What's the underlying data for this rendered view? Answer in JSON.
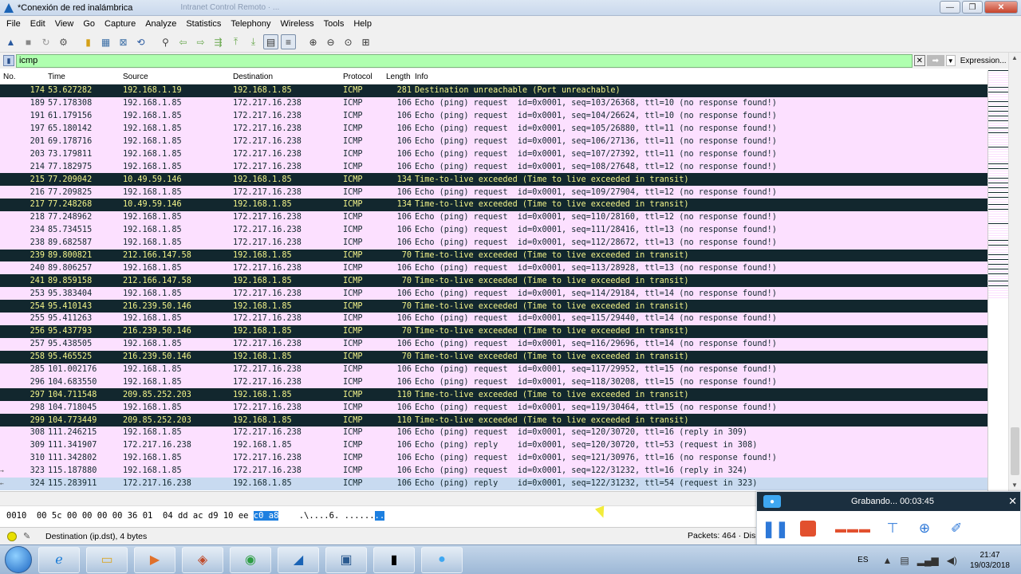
{
  "window": {
    "title": "*Conexión de red inalámbrica",
    "ghost_tabs": "Intranet Control Remoto · ..."
  },
  "menu": [
    "File",
    "Edit",
    "View",
    "Go",
    "Capture",
    "Analyze",
    "Statistics",
    "Telephony",
    "Wireless",
    "Tools",
    "Help"
  ],
  "filter": {
    "value": "icmp",
    "expression_label": "Expression...",
    "plus_label": "+"
  },
  "columns": {
    "no": "No.",
    "time": "Time",
    "source": "Source",
    "destination": "Destination",
    "protocol": "Protocol",
    "length": "Length",
    "info": "Info"
  },
  "packets": [
    {
      "no": "174",
      "time": "53.627282",
      "src": "192.168.1.19",
      "dst": "192.168.1.85",
      "proto": "ICMP",
      "len": "281",
      "info": "Destination unreachable (Port unreachable)",
      "type": "err"
    },
    {
      "no": "189",
      "time": "57.178308",
      "src": "192.168.1.85",
      "dst": "172.217.16.238",
      "proto": "ICMP",
      "len": "106",
      "info": "Echo (ping) request  id=0x0001, seq=103/26368, ttl=10 (no response found!)",
      "type": "normal"
    },
    {
      "no": "191",
      "time": "61.179156",
      "src": "192.168.1.85",
      "dst": "172.217.16.238",
      "proto": "ICMP",
      "len": "106",
      "info": "Echo (ping) request  id=0x0001, seq=104/26624, ttl=10 (no response found!)",
      "type": "normal"
    },
    {
      "no": "197",
      "time": "65.180142",
      "src": "192.168.1.85",
      "dst": "172.217.16.238",
      "proto": "ICMP",
      "len": "106",
      "info": "Echo (ping) request  id=0x0001, seq=105/26880, ttl=11 (no response found!)",
      "type": "normal"
    },
    {
      "no": "201",
      "time": "69.178716",
      "src": "192.168.1.85",
      "dst": "172.217.16.238",
      "proto": "ICMP",
      "len": "106",
      "info": "Echo (ping) request  id=0x0001, seq=106/27136, ttl=11 (no response found!)",
      "type": "normal"
    },
    {
      "no": "203",
      "time": "73.179811",
      "src": "192.168.1.85",
      "dst": "172.217.16.238",
      "proto": "ICMP",
      "len": "106",
      "info": "Echo (ping) request  id=0x0001, seq=107/27392, ttl=11 (no response found!)",
      "type": "normal"
    },
    {
      "no": "214",
      "time": "77.182975",
      "src": "192.168.1.85",
      "dst": "172.217.16.238",
      "proto": "ICMP",
      "len": "106",
      "info": "Echo (ping) request  id=0x0001, seq=108/27648, ttl=12 (no response found!)",
      "type": "normal"
    },
    {
      "no": "215",
      "time": "77.209042",
      "src": "10.49.59.146",
      "dst": "192.168.1.85",
      "proto": "ICMP",
      "len": "134",
      "info": "Time-to-live exceeded (Time to live exceeded in transit)",
      "type": "err"
    },
    {
      "no": "216",
      "time": "77.209825",
      "src": "192.168.1.85",
      "dst": "172.217.16.238",
      "proto": "ICMP",
      "len": "106",
      "info": "Echo (ping) request  id=0x0001, seq=109/27904, ttl=12 (no response found!)",
      "type": "normal"
    },
    {
      "no": "217",
      "time": "77.248268",
      "src": "10.49.59.146",
      "dst": "192.168.1.85",
      "proto": "ICMP",
      "len": "134",
      "info": "Time-to-live exceeded (Time to live exceeded in transit)",
      "type": "err"
    },
    {
      "no": "218",
      "time": "77.248962",
      "src": "192.168.1.85",
      "dst": "172.217.16.238",
      "proto": "ICMP",
      "len": "106",
      "info": "Echo (ping) request  id=0x0001, seq=110/28160, ttl=12 (no response found!)",
      "type": "normal"
    },
    {
      "no": "234",
      "time": "85.734515",
      "src": "192.168.1.85",
      "dst": "172.217.16.238",
      "proto": "ICMP",
      "len": "106",
      "info": "Echo (ping) request  id=0x0001, seq=111/28416, ttl=13 (no response found!)",
      "type": "normal"
    },
    {
      "no": "238",
      "time": "89.682587",
      "src": "192.168.1.85",
      "dst": "172.217.16.238",
      "proto": "ICMP",
      "len": "106",
      "info": "Echo (ping) request  id=0x0001, seq=112/28672, ttl=13 (no response found!)",
      "type": "normal"
    },
    {
      "no": "239",
      "time": "89.800821",
      "src": "212.166.147.58",
      "dst": "192.168.1.85",
      "proto": "ICMP",
      "len": "70",
      "info": "Time-to-live exceeded (Time to live exceeded in transit)",
      "type": "err"
    },
    {
      "no": "240",
      "time": "89.806257",
      "src": "192.168.1.85",
      "dst": "172.217.16.238",
      "proto": "ICMP",
      "len": "106",
      "info": "Echo (ping) request  id=0x0001, seq=113/28928, ttl=13 (no response found!)",
      "type": "normal"
    },
    {
      "no": "241",
      "time": "89.859158",
      "src": "212.166.147.58",
      "dst": "192.168.1.85",
      "proto": "ICMP",
      "len": "70",
      "info": "Time-to-live exceeded (Time to live exceeded in transit)",
      "type": "err"
    },
    {
      "no": "253",
      "time": "95.383404",
      "src": "192.168.1.85",
      "dst": "172.217.16.238",
      "proto": "ICMP",
      "len": "106",
      "info": "Echo (ping) request  id=0x0001, seq=114/29184, ttl=14 (no response found!)",
      "type": "normal"
    },
    {
      "no": "254",
      "time": "95.410143",
      "src": "216.239.50.146",
      "dst": "192.168.1.85",
      "proto": "ICMP",
      "len": "70",
      "info": "Time-to-live exceeded (Time to live exceeded in transit)",
      "type": "err"
    },
    {
      "no": "255",
      "time": "95.411263",
      "src": "192.168.1.85",
      "dst": "172.217.16.238",
      "proto": "ICMP",
      "len": "106",
      "info": "Echo (ping) request  id=0x0001, seq=115/29440, ttl=14 (no response found!)",
      "type": "normal"
    },
    {
      "no": "256",
      "time": "95.437793",
      "src": "216.239.50.146",
      "dst": "192.168.1.85",
      "proto": "ICMP",
      "len": "70",
      "info": "Time-to-live exceeded (Time to live exceeded in transit)",
      "type": "err"
    },
    {
      "no": "257",
      "time": "95.438505",
      "src": "192.168.1.85",
      "dst": "172.217.16.238",
      "proto": "ICMP",
      "len": "106",
      "info": "Echo (ping) request  id=0x0001, seq=116/29696, ttl=14 (no response found!)",
      "type": "normal"
    },
    {
      "no": "258",
      "time": "95.465525",
      "src": "216.239.50.146",
      "dst": "192.168.1.85",
      "proto": "ICMP",
      "len": "70",
      "info": "Time-to-live exceeded (Time to live exceeded in transit)",
      "type": "err"
    },
    {
      "no": "285",
      "time": "101.002176",
      "src": "192.168.1.85",
      "dst": "172.217.16.238",
      "proto": "ICMP",
      "len": "106",
      "info": "Echo (ping) request  id=0x0001, seq=117/29952, ttl=15 (no response found!)",
      "type": "normal"
    },
    {
      "no": "296",
      "time": "104.683550",
      "src": "192.168.1.85",
      "dst": "172.217.16.238",
      "proto": "ICMP",
      "len": "106",
      "info": "Echo (ping) request  id=0x0001, seq=118/30208, ttl=15 (no response found!)",
      "type": "normal"
    },
    {
      "no": "297",
      "time": "104.711548",
      "src": "209.85.252.203",
      "dst": "192.168.1.85",
      "proto": "ICMP",
      "len": "110",
      "info": "Time-to-live exceeded (Time to live exceeded in transit)",
      "type": "err"
    },
    {
      "no": "298",
      "time": "104.718045",
      "src": "192.168.1.85",
      "dst": "172.217.16.238",
      "proto": "ICMP",
      "len": "106",
      "info": "Echo (ping) request  id=0x0001, seq=119/30464, ttl=15 (no response found!)",
      "type": "normal"
    },
    {
      "no": "299",
      "time": "104.773449",
      "src": "209.85.252.203",
      "dst": "192.168.1.85",
      "proto": "ICMP",
      "len": "110",
      "info": "Time-to-live exceeded (Time to live exceeded in transit)",
      "type": "err"
    },
    {
      "no": "308",
      "time": "111.246215",
      "src": "192.168.1.85",
      "dst": "172.217.16.238",
      "proto": "ICMP",
      "len": "106",
      "info": "Echo (ping) request  id=0x0001, seq=120/30720, ttl=16 (reply in 309)",
      "type": "normal"
    },
    {
      "no": "309",
      "time": "111.341907",
      "src": "172.217.16.238",
      "dst": "192.168.1.85",
      "proto": "ICMP",
      "len": "106",
      "info": "Echo (ping) reply    id=0x0001, seq=120/30720, ttl=53 (request in 308)",
      "type": "normal"
    },
    {
      "no": "310",
      "time": "111.342802",
      "src": "192.168.1.85",
      "dst": "172.217.16.238",
      "proto": "ICMP",
      "len": "106",
      "info": "Echo (ping) request  id=0x0001, seq=121/30976, ttl=16 (no response found!)",
      "type": "normal"
    },
    {
      "no": "323",
      "time": "115.187880",
      "src": "192.168.1.85",
      "dst": "172.217.16.238",
      "proto": "ICMP",
      "len": "106",
      "info": "Echo (ping) request  id=0x0001, seq=122/31232, ttl=16 (reply in 324)",
      "type": "normal",
      "mark": "→"
    },
    {
      "no": "324",
      "time": "115.283911",
      "src": "172.217.16.238",
      "dst": "192.168.1.85",
      "proto": "ICMP",
      "len": "106",
      "info": "Echo (ping) reply    id=0x0001, seq=122/31232, ttl=54 (request in 323)",
      "type": "sel",
      "mark": "←"
    }
  ],
  "bytes": {
    "offset": "0010",
    "hex_plain": "00 5c 00 00 00 00 36 01  04 dd ac d9 10 ee ",
    "hex_selected": "c0 a8",
    "ascii_plain": ".\\....6. ......",
    "ascii_selected": ".."
  },
  "status": {
    "field": "Destination (ip.dst), 4 bytes",
    "packets": "Packets: 464 · Disp"
  },
  "recorder": {
    "status": "Grabando... 00:03:45"
  },
  "taskbar": {
    "language": "ES",
    "time": "21:47",
    "date": "19/03/2018"
  },
  "colors": {
    "row_normal": "#fce0ff",
    "row_error": "#12272e",
    "row_error_text": "#f3f48a",
    "filter_valid": "#afffaf"
  }
}
